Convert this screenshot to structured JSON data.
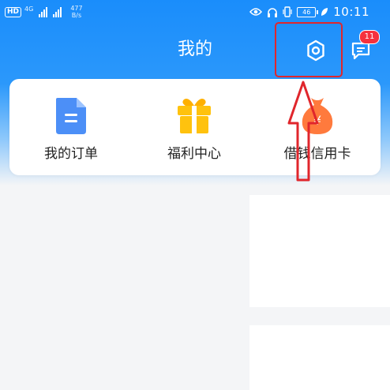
{
  "status_bar": {
    "sim1": "HD",
    "sim2": "4G",
    "speed": "477",
    "speed_unit": "B/s",
    "battery": "46",
    "time": "10:11"
  },
  "header": {
    "title": "我的",
    "message_count": "11"
  },
  "shortcuts": [
    {
      "label": "我的订单",
      "icon": "document-icon",
      "color": "#4c8ff7"
    },
    {
      "label": "福利中心",
      "icon": "gift-icon",
      "color": "#ffc20e"
    },
    {
      "label": "借钱信用卡",
      "icon": "money-bag-icon",
      "color": "#ff7a3d"
    }
  ],
  "colors": {
    "header_blue": "#1a8dfb",
    "annotation_red": "#e0262c",
    "badge_red": "#f5313d",
    "background": "#f4f5f7"
  }
}
